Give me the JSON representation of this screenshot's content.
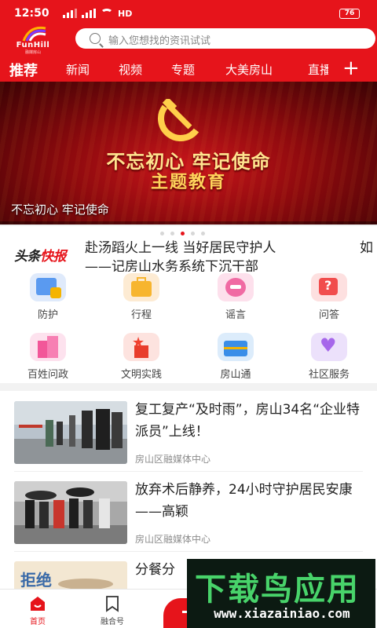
{
  "status": {
    "time": "12:50",
    "network": "HD",
    "battery": "76"
  },
  "brand": {
    "logo_text": "FunHill",
    "logo_sub": "融媒房山"
  },
  "search": {
    "placeholder": "输入您想找的资讯试试"
  },
  "tabs": [
    {
      "label": "推荐",
      "active": true
    },
    {
      "label": "新闻"
    },
    {
      "label": "视频"
    },
    {
      "label": "专题"
    },
    {
      "label": "大美房山"
    },
    {
      "label": "直播"
    }
  ],
  "banner": {
    "line1": "不忘初心 牢记使命",
    "line2": "主题教育",
    "caption": "不忘初心 牢记使命",
    "page_count": 5,
    "active_page": 2
  },
  "ticker": {
    "badge_left": "头条",
    "badge_right": "快报",
    "line1": "赴汤蹈火上一线 当好居民守护人",
    "line2": "——记房山水务系统下沉干部",
    "next_preview": "如"
  },
  "services": [
    {
      "label": "防护",
      "icon": "shield-doc-icon"
    },
    {
      "label": "行程",
      "icon": "suitcase-icon"
    },
    {
      "label": "谣言",
      "icon": "rumor-icon"
    },
    {
      "label": "问答",
      "icon": "question-icon"
    },
    {
      "label": "百姓问政",
      "icon": "building-icon"
    },
    {
      "label": "文明实践",
      "icon": "star-pavilion-icon"
    },
    {
      "label": "房山通",
      "icon": "briefcase-icon"
    },
    {
      "label": "社区服务",
      "icon": "heart-hand-icon"
    }
  ],
  "news": [
    {
      "title": "复工复产“及时雨”，房山34名“企业特派员”上线！",
      "source": "房山区融媒体中心"
    },
    {
      "title": "放弃术后静养，24小时守护居民安康——高颖",
      "source": "房山区融媒体中心"
    },
    {
      "title": "分餐分",
      "source": "",
      "thumb_text": "拒绝"
    }
  ],
  "bottom_nav": [
    {
      "label": "首页",
      "active": true
    },
    {
      "label": "融合号"
    }
  ],
  "watermark": {
    "title": "下载鸟应用",
    "url": "www.xiazainiao.com"
  },
  "colors": {
    "brand_red": "#e6141b",
    "banner_gold": "#ffd35c"
  }
}
